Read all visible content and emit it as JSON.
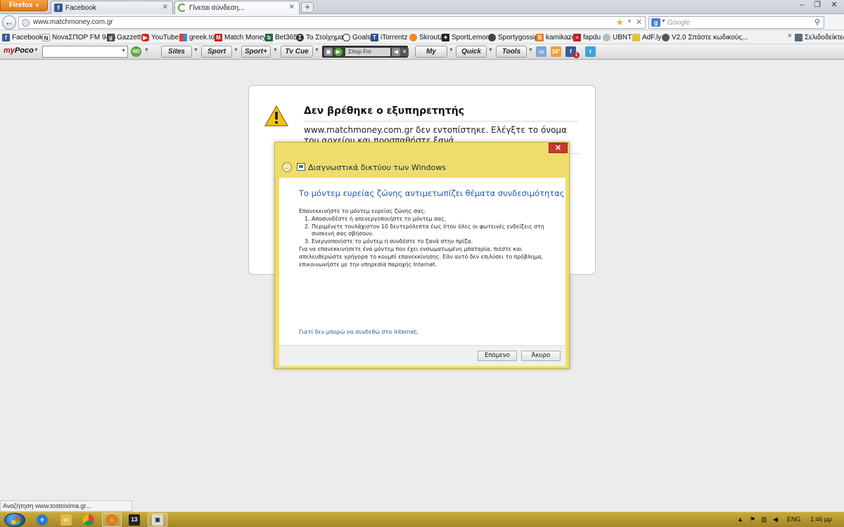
{
  "browser": {
    "menu_label": "Firefox",
    "tabs": [
      {
        "title": "Facebook",
        "active": false
      },
      {
        "title": "Γίνεται σύνδεση...",
        "active": true
      }
    ],
    "url": "www.matchmoney.com.gr",
    "search_placeholder": "Google"
  },
  "bookmarks": [
    {
      "label": "Facebook",
      "icon": "facebook-icon"
    },
    {
      "label": "NovaΣΠΟΡ FM 94.6",
      "icon": "nova-icon"
    },
    {
      "label": "Gazzetta",
      "icon": "gazzetta-icon"
    },
    {
      "label": "YouTube",
      "icon": "youtube-icon"
    },
    {
      "label": "greek.to",
      "icon": "greekto-icon"
    },
    {
      "label": "Match Money",
      "icon": "matchmoney-icon"
    },
    {
      "label": "Bet365",
      "icon": "bet365-icon"
    },
    {
      "label": "Το Στοίχημα",
      "icon": "stoixima-icon"
    },
    {
      "label": "Goals",
      "icon": "ball-icon"
    },
    {
      "label": "iTorrentz",
      "icon": "torrentz-icon"
    },
    {
      "label": "Skroutz",
      "icon": "skroutz-icon"
    },
    {
      "label": "SportLemon",
      "icon": "sportlemon-icon"
    },
    {
      "label": "Sportygossip",
      "icon": "sportygossip-icon"
    },
    {
      "label": "kamikaze",
      "icon": "blogger-icon"
    },
    {
      "label": "fapdu",
      "icon": "fapdu-icon"
    },
    {
      "label": "UBNT",
      "icon": "ubnt-icon"
    },
    {
      "label": "AdF.ly",
      "icon": "adfly-icon"
    },
    {
      "label": "V2.0 Σπάστε κωδικούς...",
      "icon": "v2-icon"
    },
    {
      "label": "Σελιδοδείκτες",
      "icon": "bookmarks-icon"
    }
  ],
  "poco_toolbar": {
    "logo_my": "my",
    "logo_poco": "Poco",
    "buttons": [
      "Sites",
      "Sport",
      "Sport+",
      "Tv Cue",
      "My",
      "Quick",
      "Tools"
    ],
    "radio_station": "Σπορ Fm",
    "weather": "16°",
    "fb_count": "1"
  },
  "error_page": {
    "title": "Δεν βρέθηκε ο εξυπηρετητής",
    "text": "www.matchmoney.com.gr δεν εντοπίστηκε. Ελέγξτε το όνομα του αρχείου και προσπαθήστε ξανά."
  },
  "dialog": {
    "caption": "Διαγνωστικά δικτύου των Windows",
    "heading": "Το μόντεμ ευρείας ζώνης αντιμετωπίζει θέματα συνδεσιμότητας",
    "intro": "Επανεκκινήστε το μόντεμ ευρείας ζώνης σας:",
    "steps": [
      {
        "n": "1.",
        "text": "Αποσυνδέστε ή απενεργοποιήστε το μόντεμ σας."
      },
      {
        "n": "2.",
        "text": "Περιμένετε τουλάχιστον 10 δευτερόλεπτα έως ότου όλες οι φωτεινές ενδείξεις στη συσκευή σας σβήσουν."
      },
      {
        "n": "3.",
        "text": "Ενεργοποιήστε το μόντεμ ή συνδέστε το ξανά στην πρίζα."
      }
    ],
    "note": "Για να επανεκκινήσετε ένα μόντεμ που έχει ενσωματωμένη μπαταρία, πιέστε και απελευθερώστε γρήγορα το κουμπί επανεκκίνησης. Εάν αυτό δεν επιλύσει το πρόβλημα, επικοινωνήστε με την υπηρεσία παροχής Internet.",
    "link": "Γιατί δεν μπορώ να συνδεθώ στο Internet;",
    "next_button": "Επόμενο",
    "cancel_button": "Άκυρο"
  },
  "status_text": "Αναζήτηση www.tostoixima.gr...",
  "taskbar": {
    "language": "ENG",
    "time": "1:46 μμ"
  }
}
